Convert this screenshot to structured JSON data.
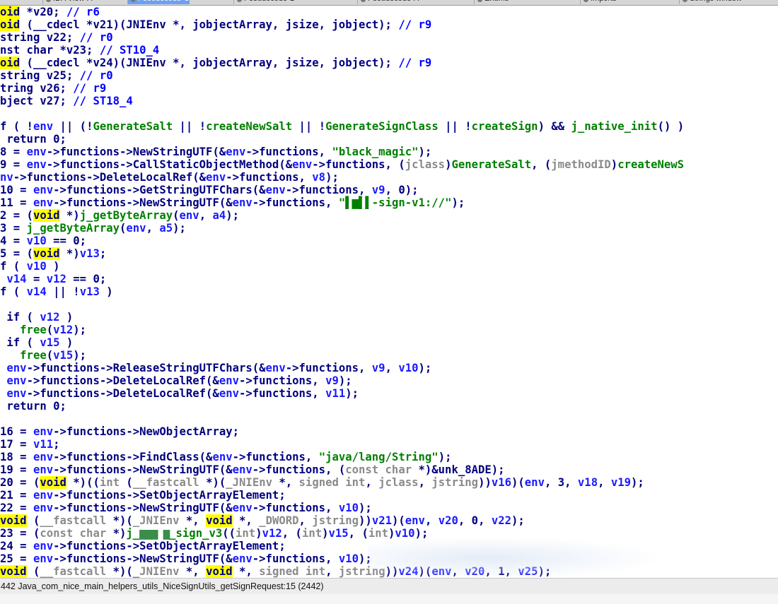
{
  "tabs": [
    {
      "label": "IDA View-A"
    },
    {
      "label": "Pseudocode-C"
    },
    {
      "label": "Pseudocode-B"
    },
    {
      "label": "Pseudocode-A"
    },
    {
      "label": "Enums"
    },
    {
      "label": "Imports"
    },
    {
      "label": "Strings window"
    }
  ],
  "code_lines": [
    {
      "segs": [
        {
          "t": "oid",
          "c": "void"
        },
        {
          "t": " *v20; "
        },
        {
          "t": "// r6",
          "c": "cmt"
        }
      ]
    },
    {
      "segs": [
        {
          "t": "oid",
          "c": "void"
        },
        {
          "t": " (__cdecl *v21)(JNIEnv *, jobjectArray, jsize, jobject); "
        },
        {
          "t": "// r9",
          "c": "cmt"
        }
      ]
    },
    {
      "segs": [
        {
          "t": "string v22; "
        },
        {
          "t": "// r0",
          "c": "cmt"
        }
      ]
    },
    {
      "segs": [
        {
          "t": "nst char *v23; "
        },
        {
          "t": "// ST10_4",
          "c": "cmt"
        }
      ]
    },
    {
      "segs": [
        {
          "t": "oid",
          "c": "void"
        },
        {
          "t": " (__cdecl *v24)(JNIEnv *, jobjectArray, jsize, jobject); "
        },
        {
          "t": "// r9",
          "c": "cmt"
        }
      ]
    },
    {
      "segs": [
        {
          "t": "string v25; "
        },
        {
          "t": "// r0",
          "c": "cmt"
        }
      ]
    },
    {
      "segs": [
        {
          "t": "tring v26; "
        },
        {
          "t": "// r9",
          "c": "cmt"
        }
      ]
    },
    {
      "segs": [
        {
          "t": "bject v27; "
        },
        {
          "t": "// ST18_4",
          "c": "cmt"
        }
      ]
    },
    {
      "segs": [
        {
          "t": ""
        }
      ]
    },
    {
      "segs": [
        {
          "t": "f ( !"
        },
        {
          "t": "env",
          "c": "lv"
        },
        {
          "t": " || (!"
        },
        {
          "t": "GenerateSalt",
          "c": "imp"
        },
        {
          "t": " || !"
        },
        {
          "t": "createNewSalt",
          "c": "imp"
        },
        {
          "t": " || !"
        },
        {
          "t": "GenerateSignClass",
          "c": "imp"
        },
        {
          "t": " || !"
        },
        {
          "t": "createSign",
          "c": "imp"
        },
        {
          "t": ") && "
        },
        {
          "t": "j_native_init",
          "c": "ex"
        },
        {
          "t": "() )"
        }
      ]
    },
    {
      "segs": [
        {
          "t": " return 0;"
        }
      ]
    },
    {
      "segs": [
        {
          "t": "8 = "
        },
        {
          "t": "env",
          "c": "lv"
        },
        {
          "t": "->functions->NewStringUTF(&"
        },
        {
          "t": "env",
          "c": "lv"
        },
        {
          "t": "->functions, "
        },
        {
          "t": "\"black_magic\"",
          "c": "str"
        },
        {
          "t": ");"
        }
      ]
    },
    {
      "segs": [
        {
          "t": "9 = "
        },
        {
          "t": "env",
          "c": "lv"
        },
        {
          "t": "->functions->CallStaticObjectMethod(&"
        },
        {
          "t": "env",
          "c": "lv"
        },
        {
          "t": "->functions, ("
        },
        {
          "t": "jclass",
          "c": "gv"
        },
        {
          "t": ")"
        },
        {
          "t": "GenerateSalt",
          "c": "imp"
        },
        {
          "t": ", ("
        },
        {
          "t": "jmethodID",
          "c": "gv"
        },
        {
          "t": ")"
        },
        {
          "t": "createNewS",
          "c": "imp"
        }
      ]
    },
    {
      "segs": [
        {
          "t": "nv",
          "c": "lv"
        },
        {
          "t": "->functions->DeleteLocalRef(&"
        },
        {
          "t": "env",
          "c": "lv"
        },
        {
          "t": "->functions, "
        },
        {
          "t": "v8",
          "c": "lv"
        },
        {
          "t": ");"
        }
      ]
    },
    {
      "segs": [
        {
          "t": "10 = "
        },
        {
          "t": "env",
          "c": "lv"
        },
        {
          "t": "->functions->GetStringUTFChars(&"
        },
        {
          "t": "env",
          "c": "lv"
        },
        {
          "t": "->functions, "
        },
        {
          "t": "v9",
          "c": "lv"
        },
        {
          "t": ", 0);"
        }
      ]
    },
    {
      "segs": [
        {
          "t": "11 = "
        },
        {
          "t": "env",
          "c": "lv"
        },
        {
          "t": "->functions->NewStringUTF(&"
        },
        {
          "t": "env",
          "c": "lv"
        },
        {
          "t": "->functions, "
        },
        {
          "t": "\"▌▆▌▌",
          "c": "str"
        },
        {
          "t": "-sign-v1://\"",
          "c": "str"
        },
        {
          "t": ");"
        }
      ]
    },
    {
      "segs": [
        {
          "t": "2 = ("
        },
        {
          "t": "void",
          "c": "void"
        },
        {
          "t": " *)"
        },
        {
          "t": "j_getByteArray",
          "c": "ex"
        },
        {
          "t": "("
        },
        {
          "t": "env",
          "c": "lv"
        },
        {
          "t": ", "
        },
        {
          "t": "a4",
          "c": "lv"
        },
        {
          "t": ");"
        }
      ]
    },
    {
      "segs": [
        {
          "t": "3 = "
        },
        {
          "t": "j_getByteArray",
          "c": "ex"
        },
        {
          "t": "("
        },
        {
          "t": "env",
          "c": "lv"
        },
        {
          "t": ", "
        },
        {
          "t": "a5",
          "c": "lv"
        },
        {
          "t": ");"
        }
      ]
    },
    {
      "segs": [
        {
          "t": "4 = "
        },
        {
          "t": "v10",
          "c": "lv"
        },
        {
          "t": " == 0;"
        }
      ]
    },
    {
      "segs": [
        {
          "t": "5 = ("
        },
        {
          "t": "void",
          "c": "void"
        },
        {
          "t": " *)"
        },
        {
          "t": "v13",
          "c": "lv"
        },
        {
          "t": ";"
        }
      ]
    },
    {
      "segs": [
        {
          "t": "f ( "
        },
        {
          "t": "v10",
          "c": "lv"
        },
        {
          "t": " )"
        }
      ]
    },
    {
      "segs": [
        {
          "t": " "
        },
        {
          "t": "v14",
          "c": "lv"
        },
        {
          "t": " = "
        },
        {
          "t": "v12",
          "c": "lv"
        },
        {
          "t": " == 0;"
        }
      ]
    },
    {
      "segs": [
        {
          "t": "f ( "
        },
        {
          "t": "v14",
          "c": "lv"
        },
        {
          "t": " || !"
        },
        {
          "t": "v13",
          "c": "lv"
        },
        {
          "t": " )"
        }
      ]
    },
    {
      "segs": [
        {
          "t": ""
        }
      ]
    },
    {
      "segs": [
        {
          "t": " if ( "
        },
        {
          "t": "v12",
          "c": "lv"
        },
        {
          "t": " )"
        }
      ]
    },
    {
      "segs": [
        {
          "t": "   "
        },
        {
          "t": "free",
          "c": "ex"
        },
        {
          "t": "("
        },
        {
          "t": "v12",
          "c": "lv"
        },
        {
          "t": ");"
        }
      ]
    },
    {
      "segs": [
        {
          "t": " if ( "
        },
        {
          "t": "v15",
          "c": "lv"
        },
        {
          "t": " )"
        }
      ]
    },
    {
      "segs": [
        {
          "t": "   "
        },
        {
          "t": "free",
          "c": "ex"
        },
        {
          "t": "("
        },
        {
          "t": "v15",
          "c": "lv"
        },
        {
          "t": ");"
        }
      ]
    },
    {
      "segs": [
        {
          "t": " "
        },
        {
          "t": "env",
          "c": "lv"
        },
        {
          "t": "->functions->ReleaseStringUTFChars(&"
        },
        {
          "t": "env",
          "c": "lv"
        },
        {
          "t": "->functions, "
        },
        {
          "t": "v9",
          "c": "lv"
        },
        {
          "t": ", "
        },
        {
          "t": "v10",
          "c": "lv"
        },
        {
          "t": ");"
        }
      ]
    },
    {
      "segs": [
        {
          "t": " "
        },
        {
          "t": "env",
          "c": "lv"
        },
        {
          "t": "->functions->DeleteLocalRef(&"
        },
        {
          "t": "env",
          "c": "lv"
        },
        {
          "t": "->functions, "
        },
        {
          "t": "v9",
          "c": "lv"
        },
        {
          "t": ");"
        }
      ]
    },
    {
      "segs": [
        {
          "t": " "
        },
        {
          "t": "env",
          "c": "lv"
        },
        {
          "t": "->functions->DeleteLocalRef(&"
        },
        {
          "t": "env",
          "c": "lv"
        },
        {
          "t": "->functions, "
        },
        {
          "t": "v11",
          "c": "lv"
        },
        {
          "t": ");"
        }
      ]
    },
    {
      "segs": [
        {
          "t": " return 0;"
        }
      ]
    },
    {
      "segs": [
        {
          "t": ""
        }
      ]
    },
    {
      "segs": [
        {
          "t": "16 = "
        },
        {
          "t": "env",
          "c": "lv"
        },
        {
          "t": "->functions->NewObjectArray;"
        }
      ]
    },
    {
      "segs": [
        {
          "t": "17 = "
        },
        {
          "t": "v11",
          "c": "lv"
        },
        {
          "t": ";"
        }
      ]
    },
    {
      "segs": [
        {
          "t": "18 = "
        },
        {
          "t": "env",
          "c": "lv"
        },
        {
          "t": "->functions->FindClass(&"
        },
        {
          "t": "env",
          "c": "lv"
        },
        {
          "t": "->functions, "
        },
        {
          "t": "\"java/lang/String\"",
          "c": "str"
        },
        {
          "t": ");"
        }
      ]
    },
    {
      "segs": [
        {
          "t": "19 = "
        },
        {
          "t": "env",
          "c": "lv"
        },
        {
          "t": "->functions->NewStringUTF(&"
        },
        {
          "t": "env",
          "c": "lv"
        },
        {
          "t": "->functions, ("
        },
        {
          "t": "const char",
          "c": "gv"
        },
        {
          "t": " *)&"
        },
        {
          "t": "unk_8ADE",
          "c": "typ"
        },
        {
          "t": ");"
        }
      ]
    },
    {
      "segs": [
        {
          "t": "20 = ("
        },
        {
          "t": "void",
          "c": "void"
        },
        {
          "t": " *)(("
        },
        {
          "t": "int",
          "c": "gv"
        },
        {
          "t": " ("
        },
        {
          "t": "__fastcall",
          "c": "gv"
        },
        {
          "t": " *)("
        },
        {
          "t": "_JNIEnv",
          "c": "gv"
        },
        {
          "t": " *, "
        },
        {
          "t": "signed int",
          "c": "gv"
        },
        {
          "t": ", "
        },
        {
          "t": "jclass",
          "c": "gv"
        },
        {
          "t": ", "
        },
        {
          "t": "jstring",
          "c": "gv"
        },
        {
          "t": "))"
        },
        {
          "t": "v16",
          "c": "lv"
        },
        {
          "t": ")("
        },
        {
          "t": "env",
          "c": "lv"
        },
        {
          "t": ", 3, "
        },
        {
          "t": "v18",
          "c": "lv"
        },
        {
          "t": ", "
        },
        {
          "t": "v19",
          "c": "lv"
        },
        {
          "t": ");"
        }
      ]
    },
    {
      "segs": [
        {
          "t": "21 = "
        },
        {
          "t": "env",
          "c": "lv"
        },
        {
          "t": "->functions->SetObjectArrayElement;"
        }
      ]
    },
    {
      "segs": [
        {
          "t": "22 = "
        },
        {
          "t": "env",
          "c": "lv"
        },
        {
          "t": "->functions->NewStringUTF(&"
        },
        {
          "t": "env",
          "c": "lv"
        },
        {
          "t": "->functions, "
        },
        {
          "t": "v10",
          "c": "lv"
        },
        {
          "t": ");"
        }
      ]
    },
    {
      "segs": [
        {
          "t": "void",
          "c": "void"
        },
        {
          "t": " ("
        },
        {
          "t": "__fastcall",
          "c": "gv"
        },
        {
          "t": " *)("
        },
        {
          "t": "_JNIEnv",
          "c": "gv"
        },
        {
          "t": " *, "
        },
        {
          "t": "void",
          "c": "void"
        },
        {
          "t": " *, "
        },
        {
          "t": "_DWORD",
          "c": "gv"
        },
        {
          "t": ", "
        },
        {
          "t": "jstring",
          "c": "gv"
        },
        {
          "t": "))"
        },
        {
          "t": "v21",
          "c": "lv"
        },
        {
          "t": ")("
        },
        {
          "t": "env",
          "c": "lv"
        },
        {
          "t": ", "
        },
        {
          "t": "v20",
          "c": "lv"
        },
        {
          "t": ", 0, "
        },
        {
          "t": "v22",
          "c": "lv"
        },
        {
          "t": ");"
        }
      ]
    },
    {
      "segs": [
        {
          "t": "23 = ("
        },
        {
          "t": "const char",
          "c": "gv"
        },
        {
          "t": " *)"
        },
        {
          "t": "j_",
          "c": "ex"
        },
        {
          "t": "▆▆▆ ▆",
          "c": "redact"
        },
        {
          "t": "_sign_v3",
          "c": "ex"
        },
        {
          "t": "(("
        },
        {
          "t": "int",
          "c": "gv"
        },
        {
          "t": ")"
        },
        {
          "t": "v12",
          "c": "lv"
        },
        {
          "t": ", ("
        },
        {
          "t": "int",
          "c": "gv"
        },
        {
          "t": ")"
        },
        {
          "t": "v15",
          "c": "lv"
        },
        {
          "t": ", ("
        },
        {
          "t": "int",
          "c": "gv"
        },
        {
          "t": ")"
        },
        {
          "t": "v10",
          "c": "lv"
        },
        {
          "t": ");"
        }
      ]
    },
    {
      "segs": [
        {
          "t": "24 = "
        },
        {
          "t": "env",
          "c": "lv"
        },
        {
          "t": "->functions->SetObjectArrayElement;"
        }
      ]
    },
    {
      "segs": [
        {
          "t": "25 = "
        },
        {
          "t": "env",
          "c": "lv"
        },
        {
          "t": "->functions->NewStringUTF(&"
        },
        {
          "t": "env",
          "c": "lv"
        },
        {
          "t": "->functions, "
        },
        {
          "t": "v10",
          "c": "lv"
        },
        {
          "t": ");"
        }
      ]
    },
    {
      "segs": [
        {
          "t": "void",
          "c": "void"
        },
        {
          "t": " ("
        },
        {
          "t": "__fastcall",
          "c": "gv"
        },
        {
          "t": " *)("
        },
        {
          "t": "_JNIEnv",
          "c": "gv"
        },
        {
          "t": " *, "
        },
        {
          "t": "void",
          "c": "void"
        },
        {
          "t": " *, "
        },
        {
          "t": "signed int",
          "c": "gv"
        },
        {
          "t": ", "
        },
        {
          "t": "jstring",
          "c": "gv"
        },
        {
          "t": "))"
        },
        {
          "t": "v24",
          "c": "lv"
        },
        {
          "t": ")("
        },
        {
          "t": "env",
          "c": "lv"
        },
        {
          "t": ", "
        },
        {
          "t": "v20",
          "c": "lv"
        },
        {
          "t": ", 1, "
        },
        {
          "t": "v25",
          "c": "lv"
        },
        {
          "t": ");"
        }
      ]
    }
  ],
  "status_bar": {
    "text": "442  Java_com_nice_main_helpers_utils_NiceSignUtils_getSignRequest:15 (2442)"
  }
}
